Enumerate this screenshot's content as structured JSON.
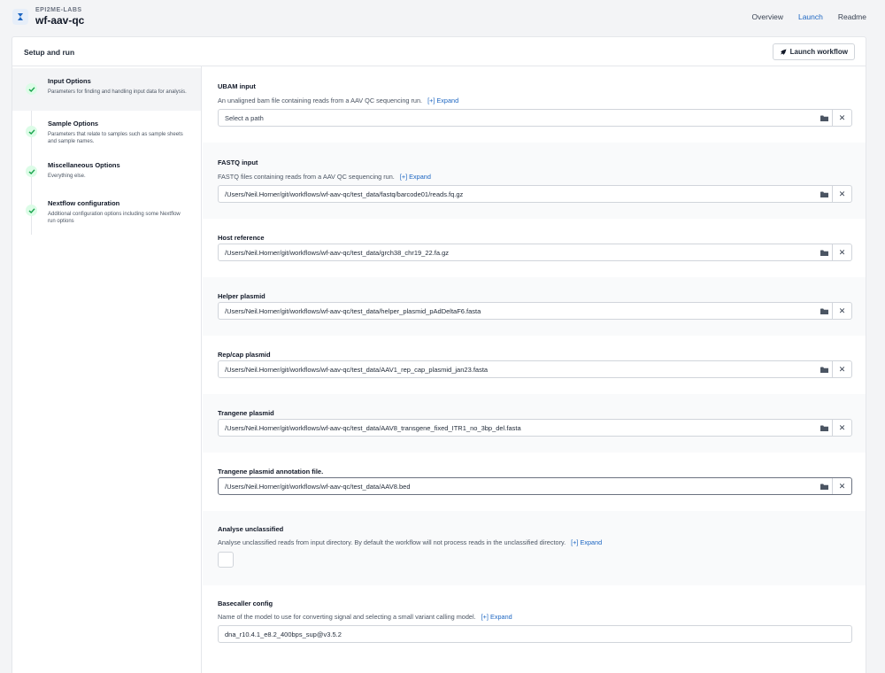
{
  "header": {
    "org": "EPI2ME-LABS",
    "app_name": "wf-aav-qc",
    "nav": {
      "overview": "Overview",
      "launch": "Launch",
      "readme": "Readme"
    }
  },
  "card": {
    "title": "Setup and run",
    "launch_button": "Launch workflow"
  },
  "sidebar": {
    "steps": [
      {
        "title": "Input Options",
        "desc": "Parameters for finding and handling input data for analysis."
      },
      {
        "title": "Sample Options",
        "desc": "Parameters that relate to samples such as sample sheets and sample names."
      },
      {
        "title": "Miscellaneous Options",
        "desc": "Everything else."
      },
      {
        "title": "Nextflow configuration",
        "desc": "Additional configuration options including some Nextflow run options"
      }
    ]
  },
  "expand_label": "[+]  Expand",
  "params": {
    "ubam": {
      "label": "UBAM input",
      "desc": "An unaligned bam file containing reads from a AAV QC sequencing run.",
      "placeholder": "Select a path"
    },
    "fastq": {
      "label": "FASTQ input",
      "desc": "FASTQ files containing reads from a AAV QC sequencing run.",
      "value": "/Users/Neil.Horner/git/workflows/wf-aav-qc/test_data/fastq/barcode01/reads.fq.gz"
    },
    "host_ref": {
      "label": "Host reference",
      "value": "/Users/Neil.Horner/git/workflows/wf-aav-qc/test_data/grch38_chr19_22.fa.gz"
    },
    "helper": {
      "label": "Helper plasmid",
      "value": "/Users/Neil.Horner/git/workflows/wf-aav-qc/test_data/helper_plasmid_pAdDeltaF6.fasta"
    },
    "repcap": {
      "label": "Rep/cap plasmid",
      "value": "/Users/Neil.Horner/git/workflows/wf-aav-qc/test_data/AAV1_rep_cap_plasmid_jan23.fasta"
    },
    "transgene": {
      "label": "Trangene plasmid",
      "value": "/Users/Neil.Horner/git/workflows/wf-aav-qc/test_data/AAV8_transgene_fixed_ITR1_no_3bp_del.fasta"
    },
    "transgene_annot": {
      "label": "Trangene plasmid annotation file.",
      "value": "/Users/Neil.Horner/git/workflows/wf-aav-qc/test_data/AAV8.bed"
    },
    "unclassified": {
      "label": "Analyse unclassified",
      "desc": "Analyse unclassified reads from input directory. By default the workflow will not process reads in the unclassified directory.",
      "checked": false
    },
    "basecaller": {
      "label": "Basecaller config",
      "desc": "Name of the model to use for converting signal and selecting a small variant calling model.",
      "value": "dna_r10.4.1_e8.2_400bps_sup@v3.5.2"
    }
  },
  "colors": {
    "accent": "#1d66c2",
    "check_green": "#16a34a",
    "check_bg": "#dcfce7"
  },
  "icons": {
    "logo": "epi2me-logo-icon",
    "check": "check-icon",
    "folder": "folder-icon",
    "clear": "close-icon",
    "rocket": "rocket-icon"
  }
}
